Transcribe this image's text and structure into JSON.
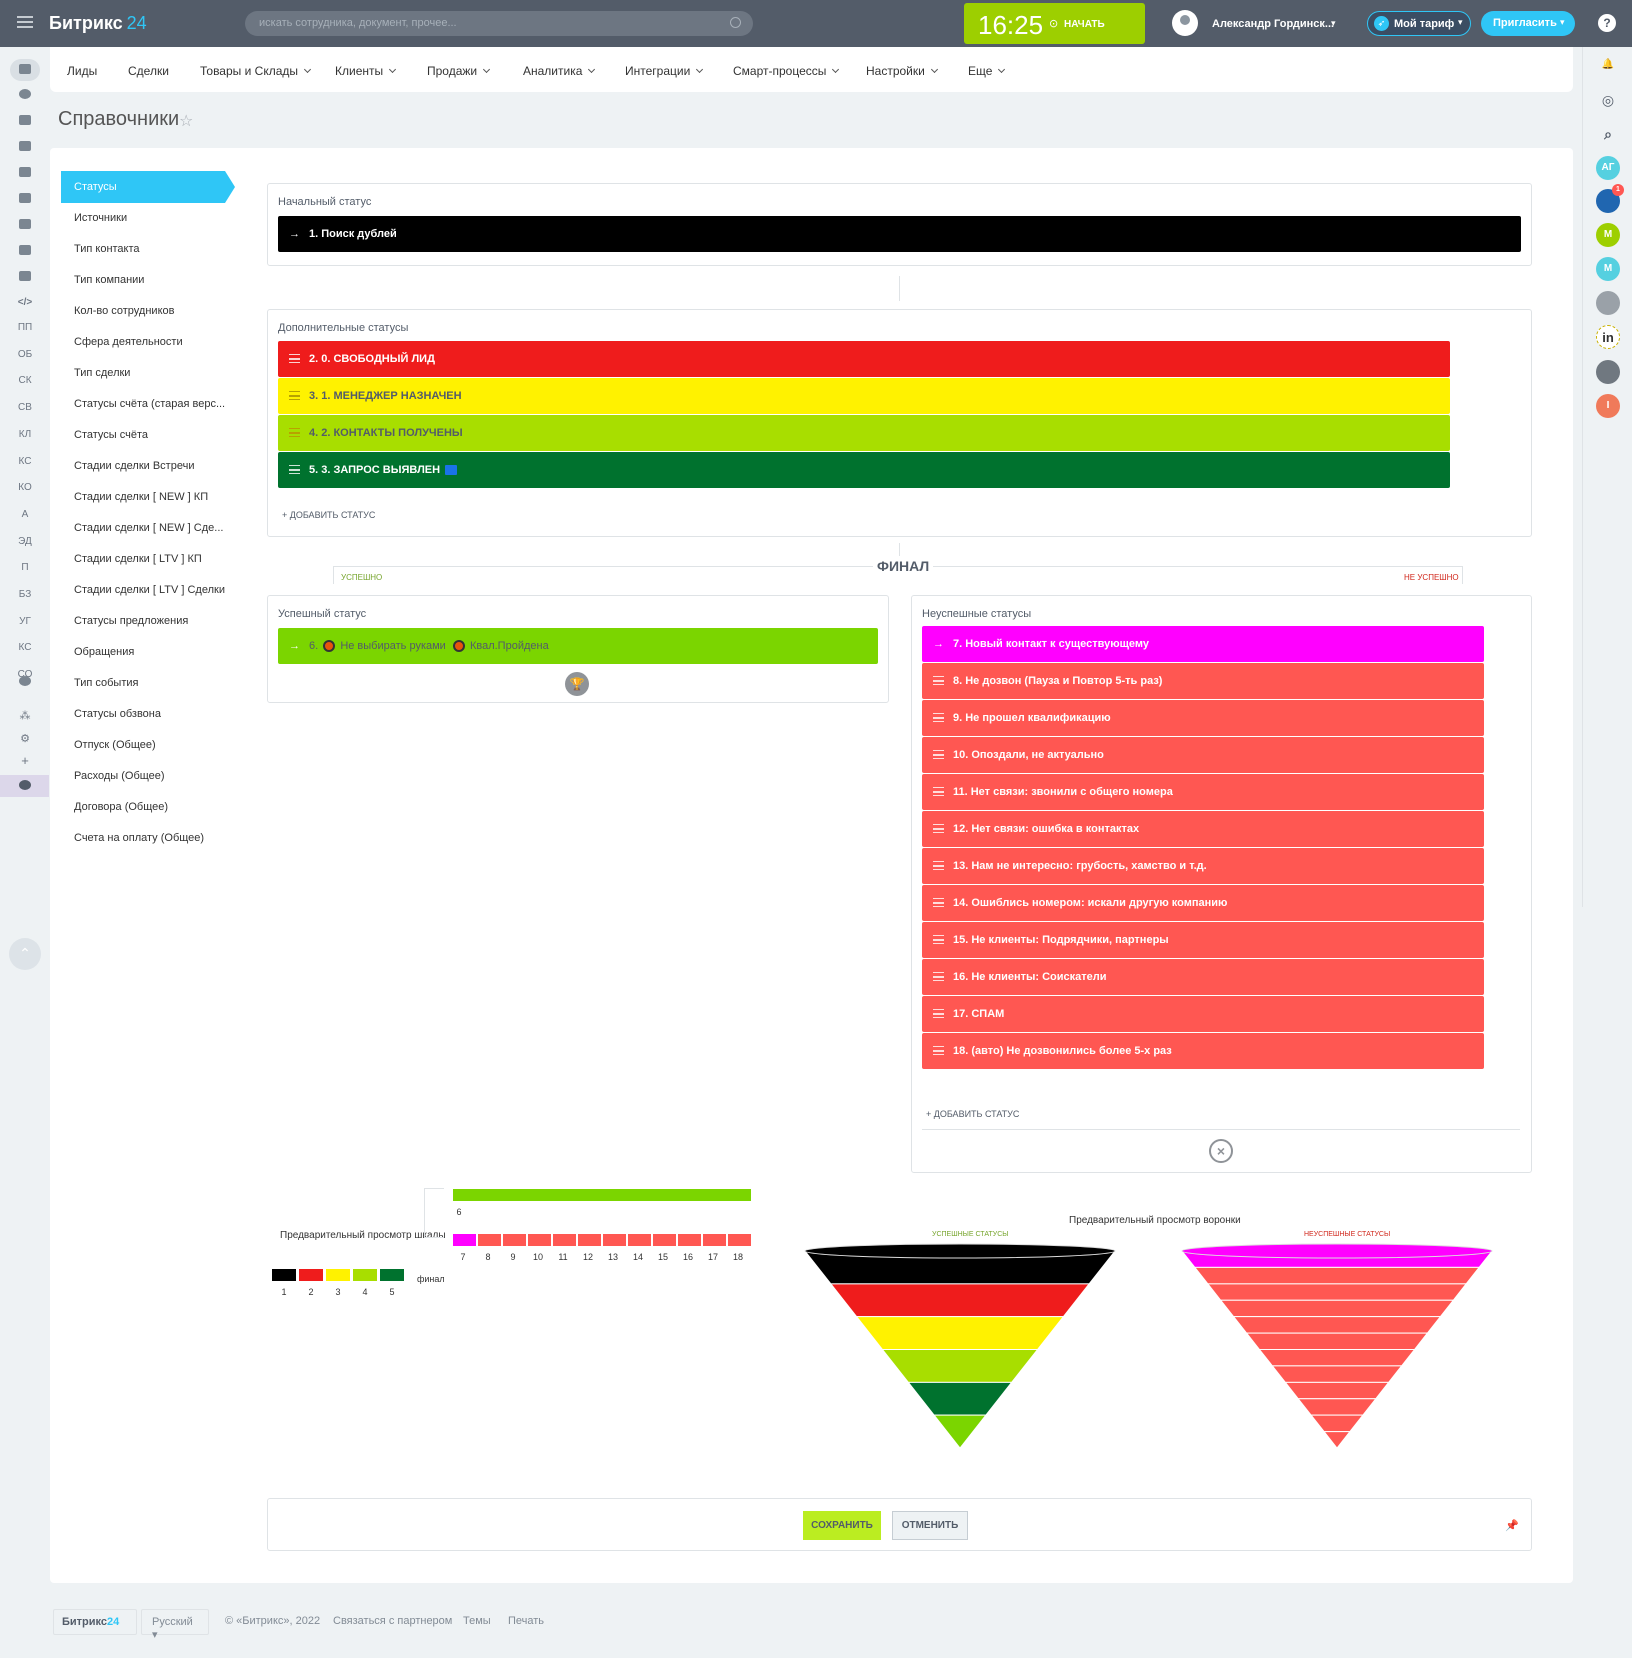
{
  "topbar": {
    "logo_text": "Битрикс",
    "logo_num": "24",
    "search_placeholder": "искать сотрудника, документ, прочее...",
    "time": "16:25",
    "start_label": "НАЧАТЬ",
    "user_name": "Александр Гординск...",
    "tariff_label": "Мой тариф",
    "invite_label": "Пригласить",
    "help": "?"
  },
  "menu": [
    "Лиды",
    "Сделки",
    "Товары и Склады",
    "Клиенты",
    "Продажи",
    "Аналитика",
    "Интеграции",
    "Смарт-процессы",
    "Настройки",
    "Еще"
  ],
  "leftbar": [
    "ПП",
    "ОБ",
    "СК",
    "СВ",
    "КЛ",
    "КС",
    "КО",
    "А",
    "ЭД",
    "П",
    "БЗ",
    "УГ",
    "КС",
    "СО"
  ],
  "rightbar": {
    "avatars": [
      "АГ",
      "М",
      "М",
      "in",
      "I"
    ],
    "badge": "1"
  },
  "page_title": "Справочники",
  "sidenav": [
    "Статусы",
    "Источники",
    "Тип контакта",
    "Тип компании",
    "Кол-во сотрудников",
    "Сфера деятельности",
    "Тип сделки",
    "Статусы счёта (старая верс...",
    "Статусы счёта",
    "Стадии сделки Встречи",
    "Стадии сделки [ NEW ] КП",
    "Стадии сделки [ NEW ] Сде...",
    "Стадии сделки [ LTV ] КП",
    "Стадии сделки [ LTV ] Сделки",
    "Статусы предложения",
    "Обращения",
    "Тип события",
    "Статусы обзвона",
    "Отпуск (Общее)",
    "Расходы (Общее)",
    "Договора (Общее)",
    "Счета на оплату (Общее)"
  ],
  "initial": {
    "title": "Начальный статус",
    "status": {
      "label": "1. Поиск дублей",
      "bg": "#000000",
      "fg": "#ffffff"
    }
  },
  "additional": {
    "title": "Дополнительные статусы",
    "add_label": "+ ДОБАВИТЬ СТАТУС",
    "statuses": [
      {
        "label": "2. 0. СВОБОДНЫЙ ЛИД",
        "bg": "#ef1c1c",
        "fg": "#ffffff"
      },
      {
        "label": "3. 1. МЕНЕДЖЕР НАЗНАЧЕН",
        "bg": "#fff200",
        "fg": "#535c69"
      },
      {
        "label": "4. 2. КОНТАКТЫ ПОЛУЧЕНЫ",
        "bg": "#a8de00",
        "fg": "#535c69"
      },
      {
        "label": "5. 3. ЗАПРОС ВЫЯВЛЕН",
        "bg": "#00722e",
        "fg": "#ffffff"
      }
    ]
  },
  "final": {
    "label": "ФИНАЛ",
    "ok_tag": "УСПЕШНО",
    "fail_tag": "НЕ УСПЕШНО"
  },
  "success": {
    "title": "Успешный статус",
    "num": "6.",
    "part1": "Не выбирать руками",
    "part2": "Квал.Пройдена",
    "bg": "#7bd500"
  },
  "failure": {
    "title": "Неуспешные статусы",
    "add_label": "+ ДОБАВИТЬ СТАТУС",
    "statuses": [
      {
        "label": "7. Новый контакт к существующему",
        "bg": "#ff00ff"
      },
      {
        "label": "8. Не дозвон (Пауза и Повтор 5-ть раз)",
        "bg": "#ff5752"
      },
      {
        "label": "9. Не прошел квалификацию",
        "bg": "#ff5752"
      },
      {
        "label": "10. Опоздали, не актуально",
        "bg": "#ff5752"
      },
      {
        "label": "11. Нет связи: звонили с общего номера",
        "bg": "#ff5752"
      },
      {
        "label": "12. Нет связи: ошибка в контактах",
        "bg": "#ff5752"
      },
      {
        "label": "13. Нам не интересно: грубость, хамство и т.д.",
        "bg": "#ff5752"
      },
      {
        "label": "14. Ошиблись номером: искали другую компанию",
        "bg": "#ff5752"
      },
      {
        "label": "15. Не клиенты: Подрядчики, партнеры",
        "bg": "#ff5752"
      },
      {
        "label": "16. Не клиенты: Соискатели",
        "bg": "#ff5752"
      },
      {
        "label": "17. СПАМ",
        "bg": "#ff5752"
      },
      {
        "label": "18. (авто) Не дозвонились более 5-х раз",
        "bg": "#ff5752"
      }
    ]
  },
  "preview": {
    "scale_title": "Предварительный просмотр шкалы",
    "funnel_title": "Предварительный просмотр воронки",
    "funnel_ok": "УСПЕШНЫЕ СТАТУСЫ",
    "funnel_fail": "НЕУСПЕШНЫЕ СТАТУСЫ",
    "final_word": "финал",
    "scale_main": [
      {
        "n": "1",
        "c": "#000000"
      },
      {
        "n": "2",
        "c": "#ef1c1c"
      },
      {
        "n": "3",
        "c": "#fff200"
      },
      {
        "n": "4",
        "c": "#a8de00"
      },
      {
        "n": "5",
        "c": "#00722e"
      }
    ],
    "scale_ok": {
      "n": "6",
      "c": "#7bd500"
    },
    "scale_fail": [
      {
        "n": "7",
        "c": "#ff00ff"
      },
      {
        "n": "8",
        "c": "#ff5752"
      },
      {
        "n": "9",
        "c": "#ff5752"
      },
      {
        "n": "10",
        "c": "#ff5752"
      },
      {
        "n": "11",
        "c": "#ff5752"
      },
      {
        "n": "12",
        "c": "#ff5752"
      },
      {
        "n": "13",
        "c": "#ff5752"
      },
      {
        "n": "14",
        "c": "#ff5752"
      },
      {
        "n": "15",
        "c": "#ff5752"
      },
      {
        "n": "16",
        "c": "#ff5752"
      },
      {
        "n": "17",
        "c": "#ff5752"
      },
      {
        "n": "18",
        "c": "#ff5752"
      }
    ]
  },
  "buttons": {
    "save": "СОХРАНИТЬ",
    "cancel": "ОТМЕНИТЬ"
  },
  "footer": {
    "logo_a": "Битрикс",
    "logo_b": "24",
    "lang": "Русский",
    "copyright": "© «Битрикс», 2022",
    "partner": "Связаться с партнером",
    "themes": "Темы",
    "print": "Печать"
  }
}
